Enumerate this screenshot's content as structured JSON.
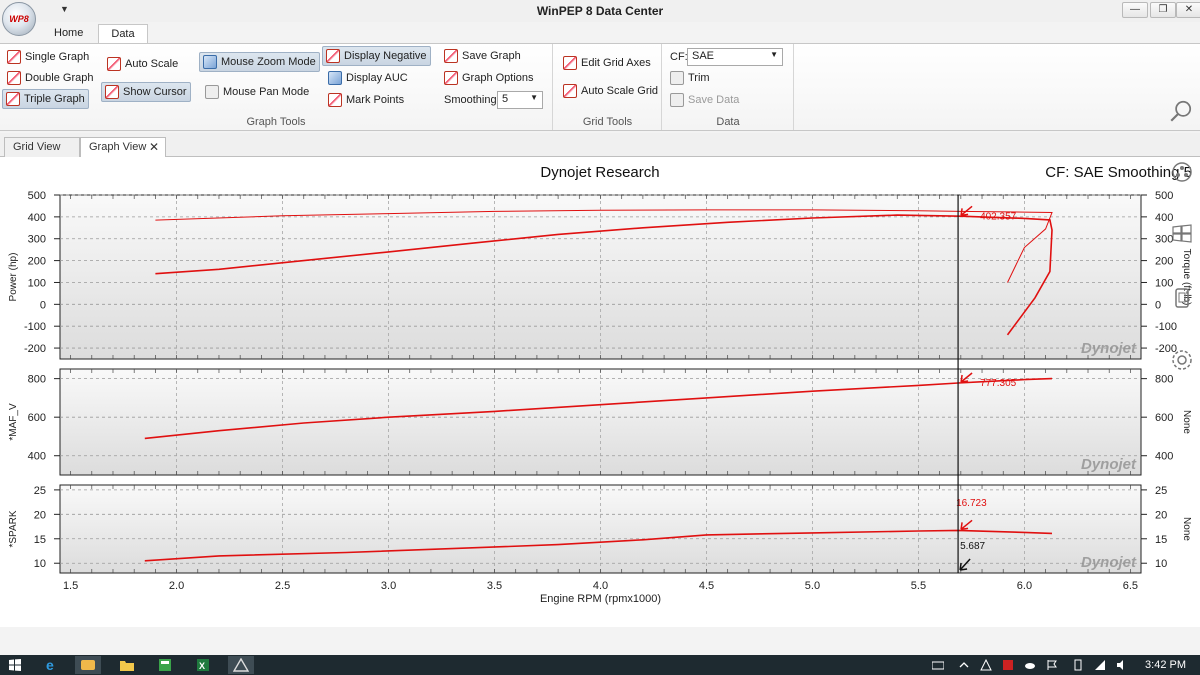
{
  "window": {
    "title": "WinPEP 8 Data Center",
    "logo_text": "WP8",
    "controls": {
      "minimize": "—",
      "restore": "❐",
      "close": "✕"
    }
  },
  "ribbon_tabs": [
    {
      "label": "Home"
    },
    {
      "label": "Data"
    }
  ],
  "ribbon": {
    "graph_tools": {
      "group_label": "Graph Tools",
      "single_graph": "Single Graph",
      "double_graph": "Double Graph",
      "triple_graph": "Triple Graph",
      "auto_scale": "Auto Scale",
      "show_cursor": "Show Cursor",
      "mouse_zoom_mode": "Mouse Zoom Mode",
      "mouse_pan_mode": "Mouse Pan Mode",
      "display_negative": "Display Negative",
      "display_auc": "Display AUC",
      "mark_points": "Mark Points",
      "save_graph": "Save Graph",
      "graph_options": "Graph Options",
      "smoothing_label": "Smoothing:",
      "smoothing_value": "5"
    },
    "grid_tools": {
      "group_label": "Grid Tools",
      "edit_grid_axes": "Edit Grid Axes",
      "auto_scale_grid": "Auto Scale Grid"
    },
    "data": {
      "group_label": "Data",
      "cf_label": "CF:",
      "cf_value": "SAE",
      "trim": "Trim",
      "save_data": "Save Data"
    }
  },
  "doc_tabs": [
    {
      "label": "Grid View"
    },
    {
      "label": "Graph View",
      "close": "✕"
    }
  ],
  "graph": {
    "title": "Dynojet Research",
    "cf_text": "CF: SAE Smoothing 5",
    "watermark": "Dynojet",
    "cursor_rpm": 5.687
  },
  "chart_data": [
    {
      "type": "line",
      "panel": "top",
      "ylabel": "Power (hp)",
      "ylabel_right": "Torque (ft-lb)",
      "ylim": [
        -250,
        500
      ],
      "yticks": [
        -200,
        -100,
        0,
        100,
        200,
        300,
        400,
        500
      ],
      "xlim": [
        1.45,
        6.55
      ],
      "series": [
        {
          "name": "Power (hp)",
          "x": [
            1.9,
            2.2,
            2.6,
            3.0,
            3.4,
            3.8,
            4.2,
            4.6,
            5.0,
            5.4,
            5.7,
            6.0,
            6.12,
            6.13,
            6.12,
            6.05,
            5.92
          ],
          "y": [
            140,
            160,
            200,
            240,
            280,
            320,
            350,
            375,
            395,
            408,
            403,
            393,
            386,
            340,
            150,
            30,
            -140
          ]
        },
        {
          "name": "Torque (ft-lb)",
          "x": [
            1.9,
            2.5,
            3.0,
            3.5,
            4.0,
            4.5,
            5.0,
            5.5,
            5.7,
            6.0,
            6.13,
            6.1,
            6.0,
            5.92
          ],
          "y": [
            385,
            405,
            415,
            425,
            430,
            432,
            432,
            428,
            425,
            422,
            420,
            345,
            260,
            100
          ]
        }
      ],
      "cursor_label": "402.357",
      "cursor_value": 402.357
    },
    {
      "type": "line",
      "panel": "middle",
      "ylabel": "*MAF_V",
      "ylabel_right": "None",
      "ylim": [
        300,
        850
      ],
      "yticks": [
        400,
        600,
        800
      ],
      "xlim": [
        1.45,
        6.55
      ],
      "series": [
        {
          "name": "*MAF_V",
          "x": [
            1.85,
            2.2,
            2.6,
            3.0,
            3.5,
            4.0,
            4.5,
            5.0,
            5.5,
            5.687,
            6.0,
            6.13
          ],
          "y": [
            490,
            530,
            570,
            600,
            630,
            665,
            700,
            735,
            765,
            777.305,
            795,
            800
          ]
        }
      ],
      "cursor_label": "777.305",
      "cursor_value": 777.305
    },
    {
      "type": "line",
      "panel": "bottom",
      "ylabel": "*SPARK",
      "ylabel_right": "None",
      "ylim": [
        8,
        26
      ],
      "yticks": [
        10,
        15,
        20,
        25
      ],
      "xlim": [
        1.45,
        6.55
      ],
      "xticks": [
        1.5,
        2.0,
        2.5,
        3.0,
        3.5,
        4.0,
        4.5,
        5.0,
        5.5,
        6.0,
        6.5
      ],
      "xlabel": "Engine RPM (rpmx1000)",
      "series": [
        {
          "name": "*SPARK",
          "x": [
            1.85,
            2.2,
            2.8,
            3.3,
            3.8,
            4.2,
            4.5,
            5.0,
            5.5,
            5.687,
            6.0,
            6.13
          ],
          "y": [
            10.5,
            11.5,
            12.2,
            13.0,
            13.8,
            14.8,
            15.8,
            16.2,
            16.6,
            16.723,
            16.3,
            16.1
          ]
        }
      ],
      "cursor_label": "16.723",
      "cursor_value": 16.723,
      "cursor_x_label": "5.687"
    }
  ],
  "taskbar": {
    "clock": "3:42 PM"
  }
}
